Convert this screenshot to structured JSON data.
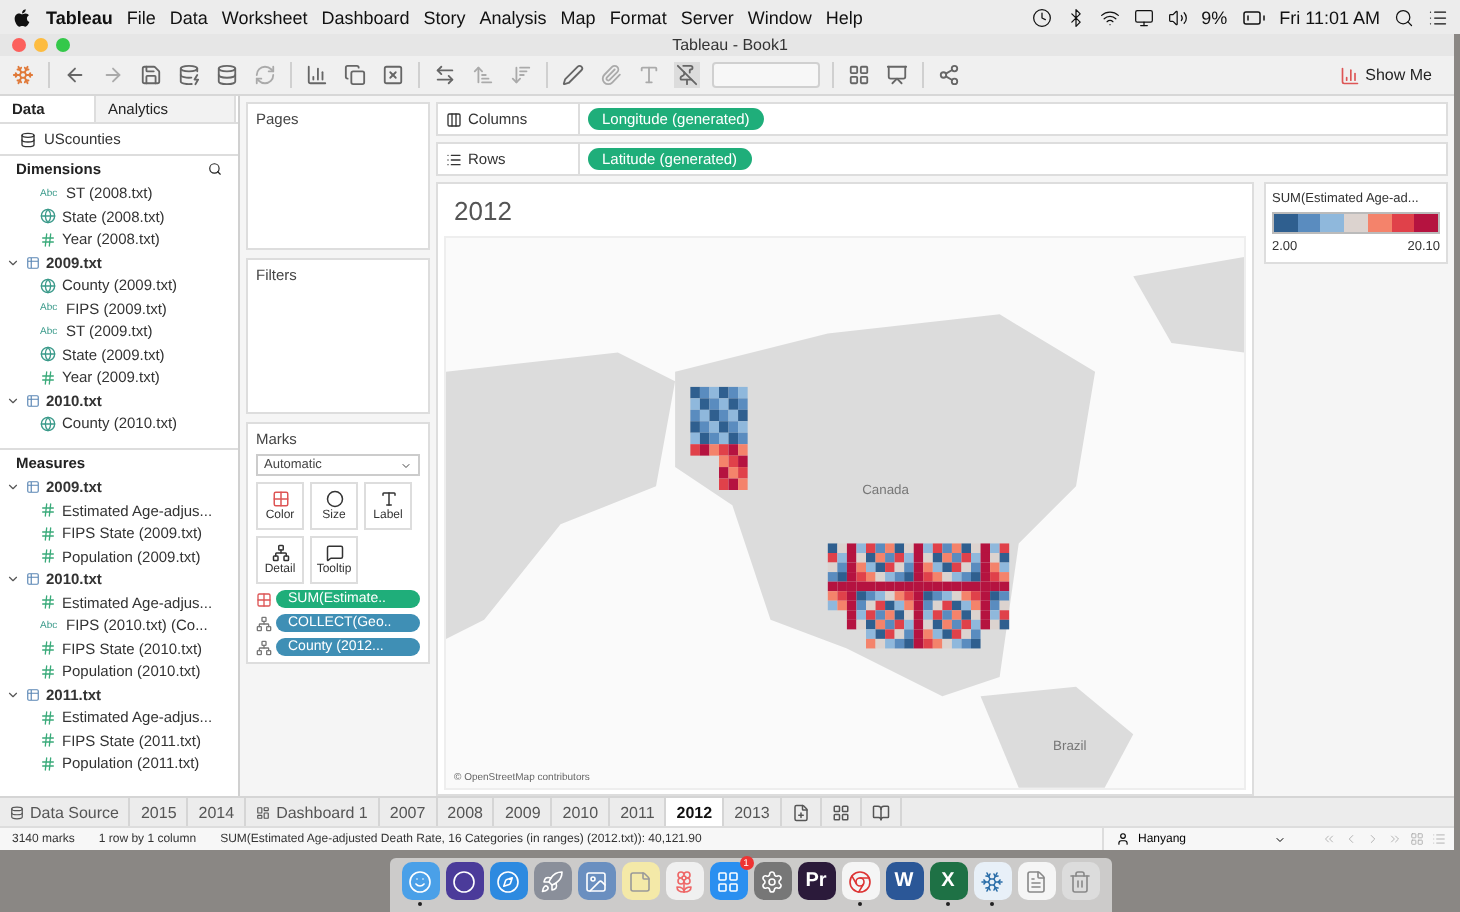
{
  "menubar": {
    "app": "Tableau",
    "menus": [
      "File",
      "Data",
      "Worksheet",
      "Dashboard",
      "Story",
      "Analysis",
      "Map",
      "Format",
      "Server",
      "Window",
      "Help"
    ],
    "battery": "9%",
    "clock": "Fri 11:01 AM"
  },
  "window": {
    "title": "Tableau - Book1"
  },
  "toolbar": {
    "show_me": "Show Me"
  },
  "data_pane": {
    "tabs": [
      {
        "label": "Data",
        "selected": true
      },
      {
        "label": "Analytics",
        "selected": false
      }
    ],
    "source": "UScounties",
    "dimensions": {
      "title": "Dimensions",
      "groups": [
        {
          "children": [
            {
              "name": "ST (2008.txt)",
              "kind": "string",
              "type_label": "Abc"
            },
            {
              "name": "State (2008.txt)",
              "kind": "geo"
            },
            {
              "name": "Year (2008.txt)",
              "kind": "number"
            }
          ]
        },
        {
          "name": "2009.txt",
          "expanded": true,
          "children": [
            {
              "name": "County (2009.txt)",
              "kind": "geo"
            },
            {
              "name": "FIPS (2009.txt)",
              "kind": "string",
              "type_label": "Abc"
            },
            {
              "name": "ST (2009.txt)",
              "kind": "string",
              "type_label": "Abc"
            },
            {
              "name": "State (2009.txt)",
              "kind": "geo"
            },
            {
              "name": "Year (2009.txt)",
              "kind": "number"
            }
          ]
        },
        {
          "name": "2010.txt",
          "expanded": true,
          "children": [
            {
              "name": "County (2010.txt)",
              "kind": "geo"
            }
          ]
        }
      ]
    },
    "measures": {
      "title": "Measures",
      "groups": [
        {
          "name": "2009.txt",
          "expanded": true,
          "children": [
            {
              "name": "Estimated Age-adjus...",
              "kind": "number"
            },
            {
              "name": "FIPS State (2009.txt)",
              "kind": "number"
            },
            {
              "name": "Population (2009.txt)",
              "kind": "number"
            }
          ]
        },
        {
          "name": "2010.txt",
          "expanded": true,
          "children": [
            {
              "name": "Estimated Age-adjus...",
              "kind": "number"
            },
            {
              "name": "FIPS (2010.txt) (Co...",
              "kind": "string",
              "type_label": "Abc"
            },
            {
              "name": "FIPS State (2010.txt)",
              "kind": "number"
            },
            {
              "name": "Population (2010.txt)",
              "kind": "number"
            }
          ]
        },
        {
          "name": "2011.txt",
          "expanded": true,
          "children": [
            {
              "name": "Estimated Age-adjus...",
              "kind": "number"
            },
            {
              "name": "FIPS State (2011.txt)",
              "kind": "number"
            },
            {
              "name": "Population (2011.txt)",
              "kind": "number"
            }
          ]
        }
      ]
    }
  },
  "cards": {
    "pages": "Pages",
    "filters": "Filters",
    "marks": {
      "title": "Marks",
      "mark_type": "Automatic",
      "buttons": [
        {
          "label": "Color",
          "kind": "color"
        },
        {
          "label": "Size",
          "kind": "size"
        },
        {
          "label": "Label",
          "kind": "label"
        },
        {
          "label": "Detail",
          "kind": "detail"
        },
        {
          "label": "Tooltip",
          "kind": "tooltip"
        }
      ],
      "pills": [
        {
          "label": "SUM(Estimate..",
          "kind": "color"
        },
        {
          "label": "COLLECT(Geo..",
          "kind": "detail"
        },
        {
          "label": "County (2012...",
          "kind": "detail"
        }
      ]
    }
  },
  "shelves": [
    {
      "label": "Columns",
      "kind": "columns",
      "pill": "Longitude (generated)"
    },
    {
      "label": "Rows",
      "kind": "rows",
      "pill": "Latitude (generated)"
    }
  ],
  "view": {
    "title": "2012",
    "map": {
      "labels": [
        "Canada",
        "Brazil"
      ],
      "attribution": "© OpenStreetMap contributors"
    }
  },
  "legend": {
    "title": "SUM(Estimated Age-ad...",
    "swatches": [
      {
        "color": "#2f5f8f"
      },
      {
        "color": "#5a8cbf"
      },
      {
        "color": "#8fb8dc"
      },
      {
        "color": "#dcd3cf"
      },
      {
        "color": "#f4836b"
      },
      {
        "color": "#e0414a"
      },
      {
        "color": "#b51340"
      }
    ],
    "min": "2.00",
    "max": "20.10"
  },
  "sheet_tabs": [
    {
      "label": "Data Source",
      "kind": "source",
      "selected": false
    },
    {
      "label": "2015",
      "kind": "sheet",
      "selected": false
    },
    {
      "label": "2014",
      "kind": "sheet",
      "selected": false
    },
    {
      "label": "Dashboard 1",
      "kind": "dashboard",
      "selected": false
    },
    {
      "label": "2007",
      "kind": "sheet",
      "selected": false
    },
    {
      "label": "2008",
      "kind": "sheet",
      "selected": false
    },
    {
      "label": "2009",
      "kind": "sheet",
      "selected": false
    },
    {
      "label": "2010",
      "kind": "sheet",
      "selected": false
    },
    {
      "label": "2011",
      "kind": "sheet",
      "selected": false
    },
    {
      "label": "2012",
      "kind": "sheet",
      "selected": true
    },
    {
      "label": "2013",
      "kind": "sheet",
      "selected": false
    }
  ],
  "status_bar": {
    "marks": "3140 marks",
    "dimensions": "1 row by 1 column",
    "summary": "SUM(Estimated Age-adjusted Death Rate, 16 Categories (in ranges) (2012.txt)): 40,121.90",
    "user": "Hanyang"
  },
  "dock": [
    {
      "kind": "finder",
      "running": true
    },
    {
      "kind": "siri",
      "running": false
    },
    {
      "kind": "safari",
      "running": false
    },
    {
      "kind": "rocket",
      "running": false
    },
    {
      "kind": "preview",
      "running": false
    },
    {
      "kind": "notes",
      "running": false
    },
    {
      "kind": "photos",
      "running": false
    },
    {
      "kind": "store",
      "running": false,
      "badge": "1"
    },
    {
      "kind": "settings",
      "running": false
    },
    {
      "kind": "letter",
      "label": "Pr",
      "running": false
    },
    {
      "kind": "chrome",
      "running": true
    },
    {
      "kind": "letter",
      "label": "W",
      "running": false
    },
    {
      "kind": "letter",
      "label": "X",
      "running": true
    },
    {
      "kind": "tableau",
      "running": true
    },
    {
      "kind": "doc",
      "running": false
    },
    {
      "kind": "trash",
      "running": false
    }
  ]
}
